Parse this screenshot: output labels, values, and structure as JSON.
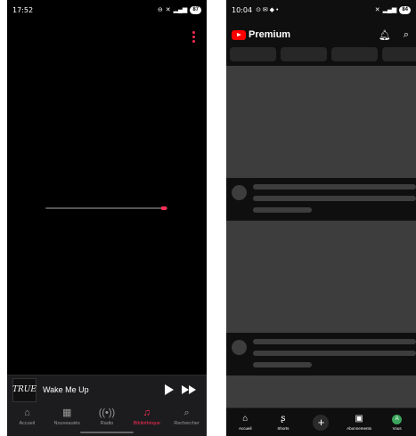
{
  "left_phone": {
    "status": {
      "time": "17:52",
      "battery": "87"
    },
    "now_playing": {
      "title": "Wake Me Up",
      "cover_text": "TRUE",
      "progress": 0.97
    },
    "tabs": [
      {
        "label": "Accueil",
        "icon": "house-icon"
      },
      {
        "label": "Nouveautés",
        "icon": "grid-icon"
      },
      {
        "label": "Radio",
        "icon": "radio-waves-icon"
      },
      {
        "label": "Bibliothèque",
        "icon": "library-music-icon",
        "active": true
      },
      {
        "label": "Rechercher",
        "icon": "search-icon"
      }
    ],
    "accent": "#ff2d55"
  },
  "right_phone": {
    "status": {
      "time": "10:04",
      "battery": "84"
    },
    "header": {
      "brand": "Premium",
      "icons": [
        "bell-icon",
        "search-icon"
      ]
    },
    "tabs": [
      {
        "label": "Accueil",
        "icon": "home-icon"
      },
      {
        "label": "Shorts",
        "icon": "shorts-icon"
      },
      {
        "label": "",
        "icon": "plus-icon"
      },
      {
        "label": "Abonnements",
        "icon": "subscriptions-icon"
      },
      {
        "label": "Vous",
        "icon": "avatar-icon",
        "avatar_letter": "A"
      }
    ],
    "brand_color": "#ff0000"
  }
}
